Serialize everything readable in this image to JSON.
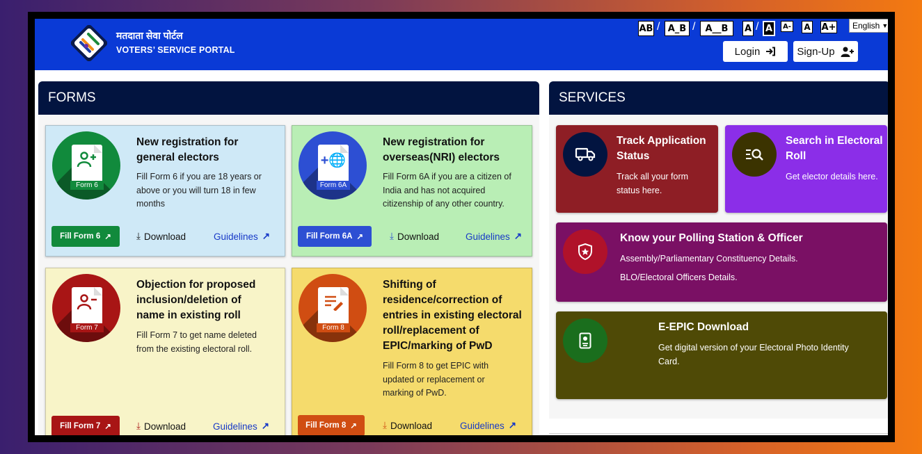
{
  "header": {
    "brand_hindi": "मतदाता सेवा पोर्टल",
    "brand_english": "VOTERS’ SERVICE PORTAL",
    "spacing_options": [
      "AB",
      "A_B",
      "A__B"
    ],
    "contrast_options": [
      "A",
      "A"
    ],
    "size_options": [
      "A-",
      "A",
      "A+"
    ],
    "language": "English",
    "login_label": "Login",
    "signup_label": "Sign-Up"
  },
  "forms": {
    "heading": "FORMS",
    "cards": [
      {
        "title": "New registration for general electors",
        "description": "Fill Form 6 if you are 18 years or above or you will turn 18 in few months",
        "badge": "Form 6",
        "button": "Fill Form 6",
        "download": "Download",
        "guidelines": "Guidelines",
        "bg": "#cfe9f7",
        "accent": "#118a3c"
      },
      {
        "title": "New registration for overseas(NRI) electors",
        "description": "Fill Form 6A if you are a citizen of India and has not acquired citizenship of any other country.",
        "badge": "Form 6A",
        "button": "Fill Form 6A",
        "download": "Download",
        "guidelines": "Guidelines",
        "bg": "#b9eeb5",
        "accent": "#2d4fd3"
      },
      {
        "title": "Objection for proposed inclusion/deletion of name in existing roll",
        "description": "Fill Form 7 to get name deleted from the existing electoral roll.",
        "badge": "Form 7",
        "button": "Fill Form 7",
        "download": "Download",
        "guidelines": "Guidelines",
        "bg": "#f8f4c8",
        "accent": "#a81515"
      },
      {
        "title": "Shifting of residence/correction of entries in existing electoral roll/replacement of EPIC/marking of PwD",
        "description": "Fill Form 8 to get EPIC with updated or replacement or marking of PwD.",
        "badge": "Form 8",
        "button": "Fill Form 8",
        "download": "Download",
        "guidelines": "Guidelines",
        "bg": "#f5db6c",
        "accent": "#d04d12"
      }
    ]
  },
  "services": {
    "heading": "SERVICES",
    "items": [
      {
        "title": "Track Application Status",
        "description": "Track all your form status here.",
        "bg": "#8e1e25",
        "circle": "#021440"
      },
      {
        "title": "Search in Electoral Roll",
        "description": "Get elector details here.",
        "bg": "#8b2ee8",
        "circle": "#3b3300"
      },
      {
        "title": "Know your Polling Station & Officer",
        "description_1": "Assembly/Parliamentary Constituency Details.",
        "description_2": "BLO/Electoral Officers Details.",
        "bg": "#7a1064",
        "circle": "#b0122a"
      },
      {
        "title": "E-EPIC Download",
        "description": "Get digital version of your Electoral Photo Identity Card.",
        "bg": "#4f4a06",
        "circle": "#1a6e1d"
      }
    ]
  }
}
